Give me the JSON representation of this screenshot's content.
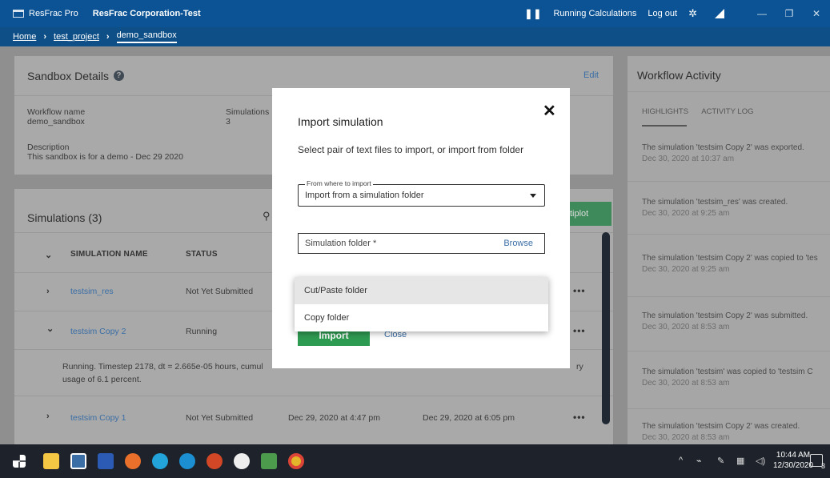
{
  "titlebar": {
    "app_name": "ResFrac Pro",
    "org_name": "ResFrac Corporation-Test",
    "running_calculations": "Running Calculations",
    "log_out": "Log out"
  },
  "breadcrumb": {
    "home": "Home",
    "project": "test_project",
    "current": "demo_sandbox"
  },
  "details": {
    "title": "Sandbox Details",
    "edit": "Edit",
    "workflow_name_label": "Workflow name",
    "workflow_name": "demo_sandbox",
    "simulations_label": "Simulations",
    "simulations_count": "3",
    "description_label": "Description",
    "description": "This sandbox is for a demo - Dec 29 2020"
  },
  "simulations": {
    "title": "Simulations (3)",
    "multiplot": "tiplot",
    "columns": [
      "SIMULATION NAME",
      "STATUS"
    ],
    "rows": [
      {
        "name": "testsim_res",
        "status": "Not Yet Submitted",
        "created": "",
        "modified": ""
      },
      {
        "name": "testsim Copy 2",
        "status": "Running",
        "created": "",
        "modified": ""
      },
      {
        "name": "testsim Copy 1",
        "status": "Not Yet Submitted",
        "created": "Dec 29, 2020 at 4:47 pm",
        "modified": "Dec 29, 2020 at 6:05 pm"
      }
    ],
    "running_note_line1": "Running. Timestep 2178, dt = 2.665e-05 hours, cumul",
    "running_note_line2": "usage of 6.1 percent.",
    "running_note_tail": "ry",
    "more": "•••"
  },
  "activity": {
    "title": "Workflow Activity",
    "tabs": [
      "HIGHLIGHTS",
      "ACTIVITY LOG"
    ],
    "items": [
      {
        "text": "The simulation 'testsim Copy 2' was exported.",
        "time": "Dec 30, 2020 at 10:37 am"
      },
      {
        "text": "The simulation 'testsim_res' was created.",
        "time": "Dec 30, 2020 at 9:25 am"
      },
      {
        "text": "The simulation 'testsim Copy 2' was copied to 'tes",
        "time": "Dec 30, 2020 at 9:25 am"
      },
      {
        "text": "The simulation 'testsim Copy 2' was submitted.",
        "time": "Dec 30, 2020 at 8:53 am"
      },
      {
        "text": "The simulation 'testsim' was copied to 'testsim C",
        "time": "Dec 30, 2020 at 8:53 am"
      },
      {
        "text": "The simulation 'testsim Copy 2' was created.",
        "time": "Dec 30, 2020 at 8:53 am"
      }
    ]
  },
  "modal": {
    "title": "Import simulation",
    "subtitle": "Select pair of text files to import, or import from folder",
    "select_label": "From where to import",
    "select_value": "Import from a simulation folder",
    "folder_placeholder": "Simulation folder *",
    "browse": "Browse",
    "import_button": "Import",
    "close_button": "Close",
    "dropdown_options": [
      "Cut/Paste folder",
      "Copy folder"
    ]
  },
  "taskbar": {
    "time": "10:44 AM",
    "date": "12/30/2020",
    "notification_count": "3"
  }
}
